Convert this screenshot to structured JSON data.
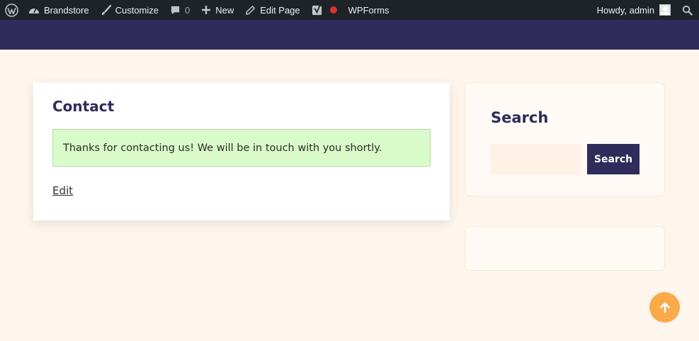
{
  "adminbar": {
    "wp_icon": "wordpress-logo-icon",
    "site": {
      "icon": "dashboard-gauge-icon",
      "label": "Brandstore"
    },
    "customize": {
      "icon": "brush-icon",
      "label": "Customize"
    },
    "comments": {
      "icon": "comment-bubble-icon",
      "count": "0"
    },
    "new": {
      "icon": "plus-icon",
      "label": "New"
    },
    "edit_page": {
      "icon": "pencil-icon",
      "label": "Edit Page"
    },
    "yoast": {
      "icon": "yoast-seo-icon",
      "status_color": "#dc3232"
    },
    "wpforms": {
      "label": "WPForms"
    },
    "howdy": "Howdy, admin",
    "search_icon": "search-icon"
  },
  "main": {
    "title": "Contact",
    "notice": "Thanks for contacting us! We will be in touch with you shortly.",
    "edit_link": "Edit"
  },
  "sidebar": {
    "search_widget": {
      "title": "Search",
      "input_value": "",
      "button_label": "Search"
    }
  },
  "back_to_top": {
    "icon": "arrow-up-icon"
  },
  "colors": {
    "adminbar_bg": "#1d2327",
    "header_bg": "#2f2b5b",
    "page_bg": "#fef5ec",
    "notice_bg": "#d9fbc9",
    "accent": "#f9ab4c"
  }
}
